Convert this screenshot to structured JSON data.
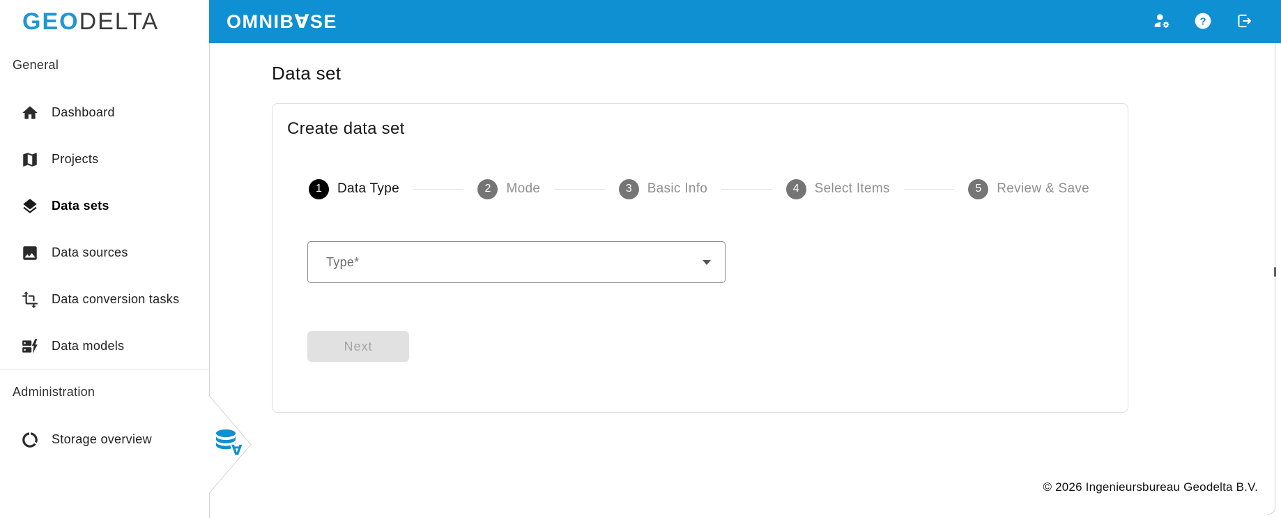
{
  "brand": {
    "geo": "GEO",
    "delta": "DELTA",
    "omnibase": {
      "pre": "OMNIB",
      "inverted_a": "∀",
      "post": "SE"
    }
  },
  "header": {
    "icons": [
      "manage-accounts-icon",
      "help-icon",
      "logout-icon"
    ]
  },
  "sidebar": {
    "sections": [
      {
        "label": "General",
        "items": [
          {
            "label": "Dashboard",
            "icon": "home-icon",
            "active": false
          },
          {
            "label": "Projects",
            "icon": "map-icon",
            "active": false
          },
          {
            "label": "Data sets",
            "icon": "layers-icon",
            "active": true
          },
          {
            "label": "Data sources",
            "icon": "image-icon",
            "active": false
          },
          {
            "label": "Data conversion tasks",
            "icon": "transform-icon",
            "active": false
          },
          {
            "label": "Data models",
            "icon": "dynamic-form-icon",
            "active": false
          }
        ]
      },
      {
        "label": "Administration",
        "items": [
          {
            "label": "Storage overview",
            "icon": "data-usage-icon",
            "active": false
          }
        ]
      }
    ]
  },
  "main": {
    "page_title": "Data set",
    "card": {
      "title": "Create data set",
      "stepper": [
        {
          "number": "1",
          "label": "Data Type",
          "active": true
        },
        {
          "number": "2",
          "label": "Mode",
          "active": false
        },
        {
          "number": "3",
          "label": "Basic Info",
          "active": false
        },
        {
          "number": "4",
          "label": "Select Items",
          "active": false
        },
        {
          "number": "5",
          "label": "Review & Save",
          "active": false
        }
      ],
      "form": {
        "type_label": "Type*"
      },
      "next_label": "Next"
    }
  },
  "footer": {
    "copyright": "© 2026 Ingenieursbureau Geodelta B.V."
  },
  "colors": {
    "brand_blue": "#0e90d2",
    "logo_blue": "#2196d3",
    "step_active_bg": "#000000",
    "step_inactive_bg": "#757575"
  }
}
